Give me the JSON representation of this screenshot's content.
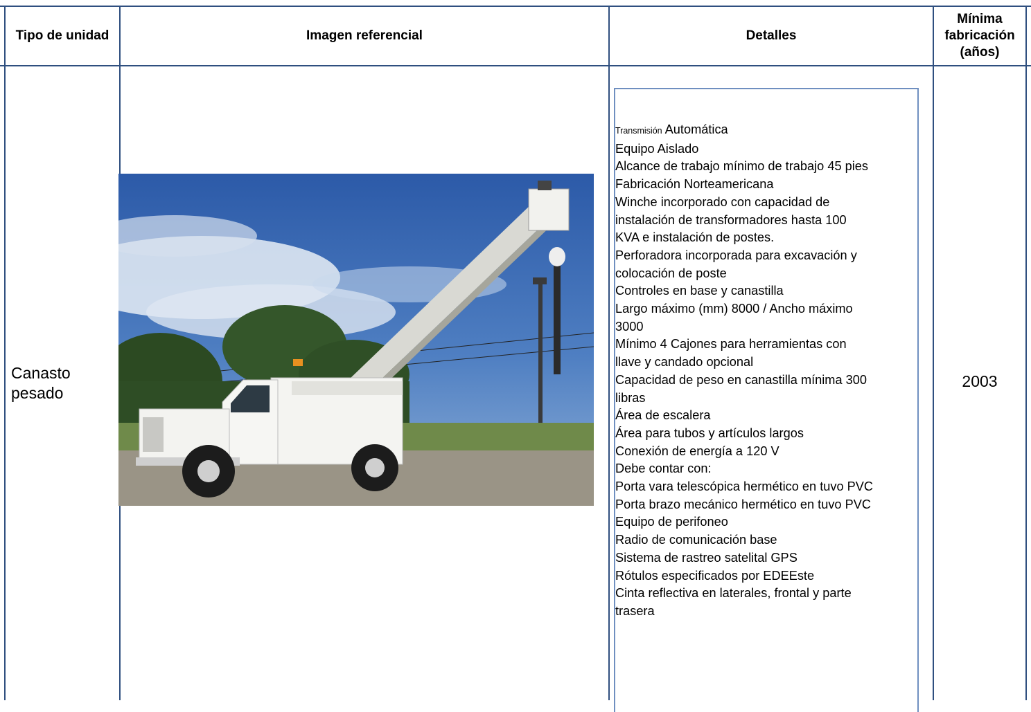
{
  "table": {
    "headers": {
      "unit_type": "Tipo de unidad",
      "image": "Imagen referencial",
      "details": "Detalles",
      "min_year_line1": "Mínima",
      "min_year_line2": "fabricación",
      "min_year_line3": "(años)"
    },
    "row": {
      "unit_type_line1": "Canasto",
      "unit_type_line2": "pesado",
      "min_year": "2003",
      "details_prefix": "Transmisión",
      "details_first_value": "Automática",
      "details_lines": [
        "Equipo Aislado",
        "Alcance de trabajo mínimo de trabajo 45 pies",
        "Fabricación Norteamericana",
        "Winche incorporado con capacidad de",
        "instalación de transformadores hasta 100",
        "KVA e instalación de postes.",
        "Perforadora incorporada para excavación y",
        "colocación de poste",
        "Controles en base y canastilla",
        "Largo máximo (mm) 8000 / Ancho máximo",
        "3000",
        "Mínimo 4 Cajones para herramientas con",
        "llave y candado opcional",
        "Capacidad de peso en canastilla mínima 300",
        "libras",
        "Área de escalera",
        "Área para tubos y artículos largos",
        "Conexión de energía a 120 V",
        "Debe contar con:",
        "Porta vara telescópica hermético en tuvo PVC",
        "Porta brazo mecánico hermético en tuvo PVC",
        "Equipo de perifoneo",
        "Radio de comunicación base",
        "Sistema de rastreo satelital GPS",
        "Rótulos especificados por EDEEste",
        "Cinta reflectiva en laterales, frontal y parte",
        "trasera"
      ]
    }
  },
  "colors": {
    "grid": "#2f4f7f",
    "details_border": "#6f8fc0"
  }
}
